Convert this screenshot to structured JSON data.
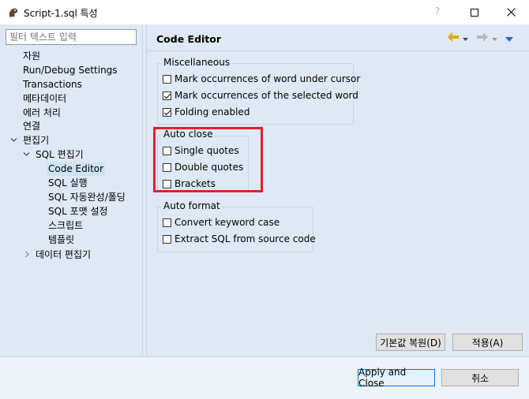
{
  "window": {
    "title": "Script-1.sql 특성",
    "icon": "dbeaver-beaver-icon",
    "help_glyph": "?"
  },
  "sidebar": {
    "filter_placeholder": "필터 텍스트 입력",
    "items": [
      {
        "label": "자원"
      },
      {
        "label": "Run/Debug Settings"
      },
      {
        "label": "Transactions"
      },
      {
        "label": "메타데이터"
      },
      {
        "label": "에러 처리"
      },
      {
        "label": "연결"
      },
      {
        "label": "편집기",
        "expanded": true
      },
      {
        "label": "SQL 편집기",
        "expanded": true
      },
      {
        "label": "Code Editor",
        "selected": true
      },
      {
        "label": "SQL 실행"
      },
      {
        "label": "SQL 자동완성/폴딩"
      },
      {
        "label": "SQL 포맷 설정"
      },
      {
        "label": "스크립트"
      },
      {
        "label": "템플릿"
      },
      {
        "label": "데이터 편집기",
        "expanded": false
      }
    ]
  },
  "main": {
    "title": "Code Editor",
    "groups": {
      "misc": {
        "label": "Miscellaneous",
        "options": [
          {
            "label": "Mark occurrences of word under cursor",
            "checked": false
          },
          {
            "label": "Mark occurrences of the selected word",
            "checked": true
          },
          {
            "label": "Folding enabled",
            "checked": true
          }
        ]
      },
      "autoclose": {
        "label": "Auto close",
        "options": [
          {
            "label": "Single quotes",
            "checked": false
          },
          {
            "label": "Double quotes",
            "checked": false
          },
          {
            "label": "Brackets",
            "checked": false
          }
        ]
      },
      "autoformat": {
        "label": "Auto format",
        "options": [
          {
            "label": "Convert keyword case",
            "checked": false
          },
          {
            "label": "Extract SQL from source code",
            "checked": false
          }
        ]
      }
    },
    "restore_defaults": "기본값 복원(D)",
    "apply": "적용(A)"
  },
  "footer": {
    "apply_close": "Apply and Close",
    "cancel": "취소"
  },
  "colors": {
    "panel_bg": "#dee9f5",
    "highlight_border": "#e3202b",
    "back_arrow": "#e8a800"
  }
}
